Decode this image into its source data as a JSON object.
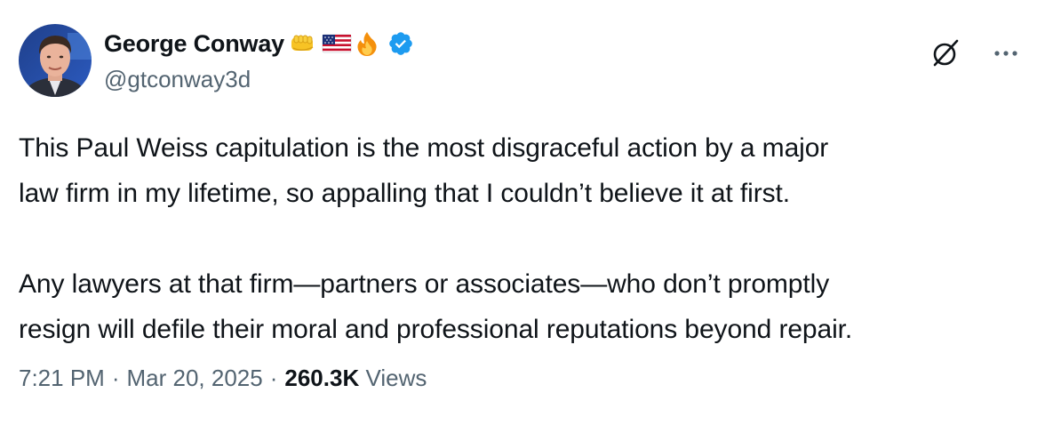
{
  "author": {
    "display_name": "George Conway",
    "handle": "@gtconway3d",
    "name_emojis": [
      "oncoming-fist-emoji",
      "us-flag-emoji",
      "fire-emoji"
    ],
    "verified": true,
    "verified_color": "#1d9bf0"
  },
  "actions": {
    "grok_icon": "grok-icon",
    "more_icon": "more-icon"
  },
  "tweet": {
    "lines": [
      "This Paul Weiss capitulation is the most disgraceful action by a major",
      "law firm in my lifetime, so appalling that I couldn’t believe it at first.",
      "Any lawyers at that firm—partners or associates—who don’t promptly",
      "resign will defile their moral and professional reputations beyond repair."
    ]
  },
  "meta": {
    "time": "7:21 PM",
    "date": "Mar 20, 2025",
    "views_count": "260.3K",
    "views_label": "Views"
  },
  "colors": {
    "text_primary": "#0f1419",
    "text_secondary": "#536471",
    "background": "#ffffff"
  }
}
